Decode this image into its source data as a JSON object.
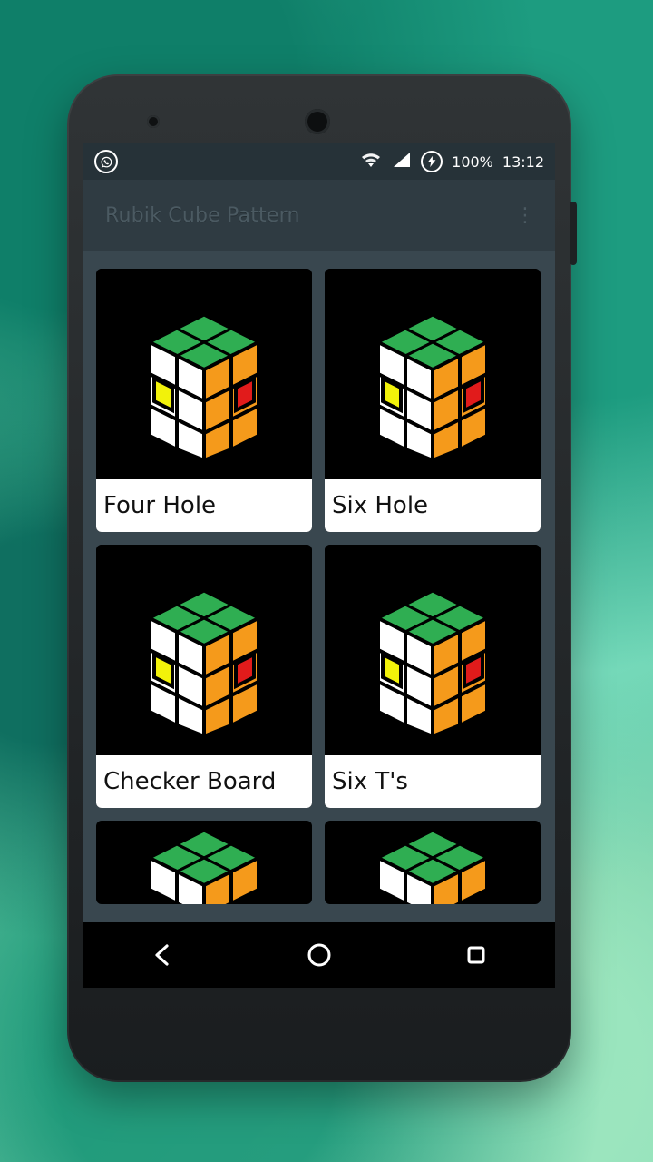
{
  "statusbar": {
    "left_icon": "whatsapp-icon",
    "battery": "100%",
    "time": "13:12",
    "right_icons": [
      "wifi-icon",
      "signal-icon",
      "battery-charging-icon"
    ]
  },
  "appbar": {
    "title": "Rubik Cube Pattern",
    "menu_icon": "more-vert-icon"
  },
  "patterns": [
    {
      "name": "Four Hole"
    },
    {
      "name": "Six Hole"
    },
    {
      "name": "Checker Board"
    },
    {
      "name": "Six T's"
    },
    {
      "name": ""
    },
    {
      "name": ""
    }
  ],
  "navbar": {
    "back_icon": "back-icon",
    "home_icon": "home-icon",
    "recents_icon": "recents-icon"
  },
  "colors": {
    "statusbar_bg": "#263238",
    "appbar_bg": "#2f3b42",
    "content_bg": "#39474f",
    "card_label_bg": "#ffffff",
    "cube_green": "#2fae52",
    "cube_white": "#ffffff",
    "cube_orange": "#f59a1b",
    "cube_yellow": "#f2f20a",
    "cube_red": "#e11b1b"
  }
}
